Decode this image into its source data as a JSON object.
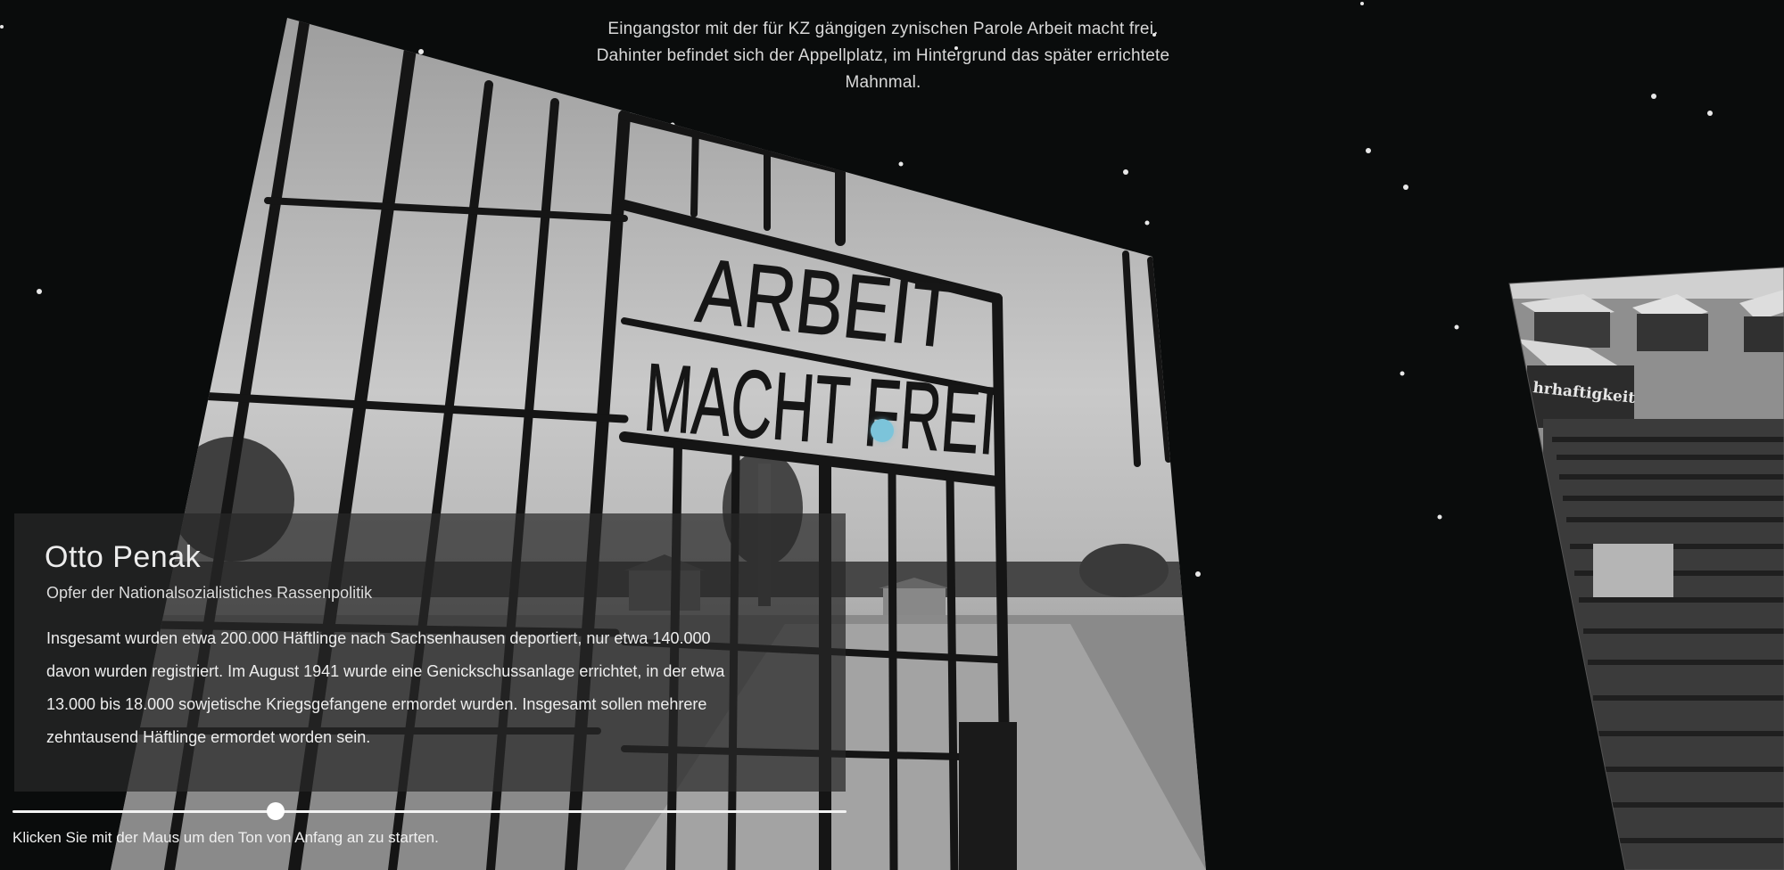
{
  "caption": {
    "line1": "Eingangstor mit der für KZ gängigen zynischen Parole Arbeit macht frei.",
    "line2": "Dahinter befindet sich der Appellplatz, im Hintergrund das später errichtete",
    "line3": "Mahnmal."
  },
  "main_photo": {
    "sign_line1": "ARBEIT",
    "sign_line2": "MACHT FREI"
  },
  "side_photo": {
    "sign_text": "hrhaftigkeit"
  },
  "info": {
    "title": "Otto Penak",
    "subtitle": "Opfer der Nationalsozialistiches Rassenpolitik",
    "text_lines": [
      "Insgesamt wurden etwa 200.000 Häftlinge nach Sachsenhausen deportiert, nur etwa 140.000",
      "davon wurden registriert. Im August 1941 wurde eine Genickschussanlage errichtet, in der etwa",
      "13.000 bis 18.000 sowjetische Kriegsgefangene ermordet wurden. Insgesamt sollen mehrere",
      "zehntausend Häftlinge ermordet worden sein."
    ]
  },
  "player": {
    "progress": 0.315,
    "hint": "Klicken Sie mit der Maus um den Ton von Anfang an zu starten."
  },
  "colors": {
    "background": "#0a0c0c",
    "hotspot": "#7cc4da",
    "panel": "#282828"
  }
}
